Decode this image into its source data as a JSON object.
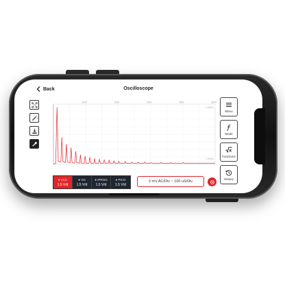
{
  "header": {
    "back_label": "Back",
    "title": "Oscilloscope"
  },
  "toolbar": {
    "items": [
      "fit-icon",
      "magic-wand-icon",
      "download-icon",
      "probe-icon"
    ]
  },
  "menu": {
    "items": [
      {
        "label": "Menu",
        "icon": "hamburger-icon"
      },
      {
        "label": "Mode",
        "icon": "function-f-icon"
      },
      {
        "label": "Functions",
        "icon": "sqrt-x-icon"
      },
      {
        "label": "History",
        "icon": "history-icon"
      }
    ]
  },
  "chart_data": {
    "type": "line",
    "x_ticks": [
      "1000",
      "2000",
      "3000",
      "4000",
      "5000"
    ],
    "x_range": [
      0,
      5000
    ],
    "grid": true,
    "corner_labels": [
      "1 Hz/Div",
      "1 Hz/Div"
    ],
    "series": [
      {
        "color": "#e0262b",
        "points": [
          [
            0,
            0.0
          ],
          [
            70,
            0.02
          ],
          [
            110,
            0.95
          ],
          [
            150,
            0.05
          ],
          [
            230,
            0.04
          ],
          [
            260,
            0.45
          ],
          [
            290,
            0.05
          ],
          [
            370,
            0.03
          ],
          [
            400,
            0.34
          ],
          [
            430,
            0.04
          ],
          [
            520,
            0.03
          ],
          [
            545,
            0.28
          ],
          [
            575,
            0.03
          ],
          [
            660,
            0.02
          ],
          [
            690,
            0.22
          ],
          [
            720,
            0.03
          ],
          [
            810,
            0.02
          ],
          [
            835,
            0.16
          ],
          [
            865,
            0.02
          ],
          [
            950,
            0.02
          ],
          [
            980,
            0.14
          ],
          [
            1010,
            0.02
          ],
          [
            1100,
            0.02
          ],
          [
            1125,
            0.12
          ],
          [
            1155,
            0.02
          ],
          [
            1250,
            0.02
          ],
          [
            1270,
            0.1
          ],
          [
            1300,
            0.02
          ],
          [
            1400,
            0.02
          ],
          [
            1420,
            0.09
          ],
          [
            1450,
            0.02
          ],
          [
            1550,
            0.02
          ],
          [
            1570,
            0.08
          ],
          [
            1600,
            0.02
          ],
          [
            1700,
            0.02
          ],
          [
            1720,
            0.07
          ],
          [
            1750,
            0.02
          ],
          [
            1850,
            0.02
          ],
          [
            1870,
            0.06
          ],
          [
            1900,
            0.02
          ],
          [
            2000,
            0.02
          ],
          [
            2020,
            0.05
          ],
          [
            2050,
            0.02
          ],
          [
            2200,
            0.02
          ],
          [
            2220,
            0.05
          ],
          [
            2250,
            0.02
          ],
          [
            2400,
            0.02
          ],
          [
            2420,
            0.04
          ],
          [
            2450,
            0.02
          ],
          [
            2600,
            0.02
          ],
          [
            2620,
            0.04
          ],
          [
            2650,
            0.02
          ],
          [
            2800,
            0.02
          ],
          [
            2820,
            0.04
          ],
          [
            2850,
            0.02
          ],
          [
            3000,
            0.02
          ],
          [
            3020,
            0.03
          ],
          [
            3050,
            0.02
          ],
          [
            3300,
            0.02
          ],
          [
            3320,
            0.03
          ],
          [
            3350,
            0.02
          ],
          [
            3600,
            0.02
          ],
          [
            3620,
            0.03
          ],
          [
            3650,
            0.02
          ],
          [
            4000,
            0.02
          ],
          [
            4020,
            0.03
          ],
          [
            4050,
            0.02
          ],
          [
            4500,
            0.02
          ],
          [
            5000,
            0.02
          ]
        ]
      }
    ]
  },
  "channels": [
    {
      "name": "VCC",
      "value": "1.5 V/d",
      "active": true
    },
    {
      "name": "VO",
      "value": "1.5 V/d",
      "active": false
    },
    {
      "name": "IPROG",
      "value": "1.5 V/d",
      "active": false
    },
    {
      "name": "PICO",
      "value": "1.5 V/d",
      "active": false
    }
  ],
  "status_text": "2 mV AC/Div ~ 100 uS/Div",
  "colors": {
    "accent": "#e0262b",
    "channel_bg": "#1f2630"
  }
}
